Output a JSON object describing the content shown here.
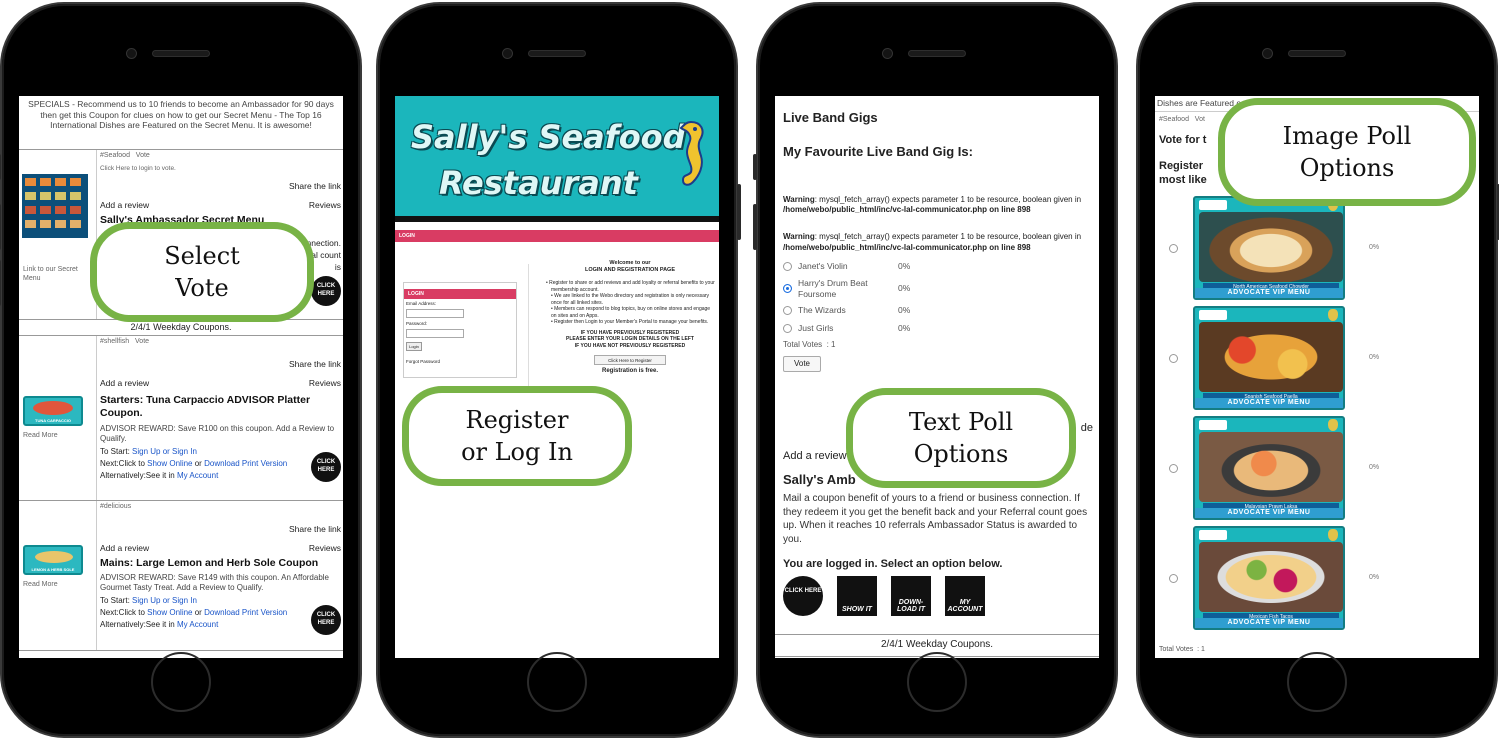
{
  "phone1": {
    "specials_text": "SPECIALS - Recommend us to 10 friends to become an Ambassador for 90 days then get this Coupon for clues on how to get our Secret Menu - The Top 16 International Dishes are Featured on the Secret Menu. It is awesome!",
    "card1": {
      "tags": "#Seafood   Vote",
      "login_note": "Click Here to login to vote.",
      "share": "Share the link",
      "add_review": "Add a review",
      "reviews": "Reviews",
      "title": "Sally's Ambassador Secret Menu",
      "side_link": "Link to our Secret Menu",
      "frag1": "connection.",
      "frag2": "rral count",
      "frag3": "is"
    },
    "weekday_bar": "2/4/1 Weekday Coupons.",
    "card2": {
      "tags": "#shellfish   Vote",
      "share": "Share the link",
      "add_review": "Add a review",
      "reviews": "Reviews",
      "title": "Starters: Tuna Carpaccio ADVISOR Platter Coupon.",
      "body": "ADVISOR REWARD: Save R100 on this coupon. Add a Review to Qualify.",
      "start_label": "To Start:",
      "start_link": "Sign Up or Sign In",
      "next_label": "Next:Click to",
      "show_online": "Show Online",
      "or": "or",
      "download": "Download Print Version",
      "alt_label": "Alternatively:See it in",
      "my_account": "My Account",
      "read_more": "Read More",
      "thumb_label": "TUNA CARPACCIO"
    },
    "card3": {
      "tags": "#delicious",
      "share": "Share the link",
      "add_review": "Add a review",
      "reviews": "Reviews",
      "title": "Mains: Large Lemon and Herb Sole Coupon",
      "body": "ADVISOR REWARD: Save R149 with this coupon. An Affordable Gourmet Tasty Treat. Add a Review to Qualify.",
      "start_label": "To Start:",
      "start_link": "Sign Up or Sign In",
      "next_label": "Next:Click to",
      "show_online": "Show Online",
      "or": "or",
      "download": "Download Print Version",
      "alt_label": "Alternatively:See it in",
      "my_account": "My Account",
      "read_more": "Read More",
      "thumb_label": "LEMON & HERB SOLE"
    },
    "badge": "CLICK HERE"
  },
  "phone2": {
    "logo_line1": "Sally's Seafood",
    "logo_line2": "Restaurant",
    "login_bar": "LOGIN",
    "login_box_title": "LOGIN",
    "email_label": "Email Address:",
    "password_label": "Password:",
    "login_button": "Login",
    "forgot": "Forgot Password",
    "welcome1": "Welcome to our",
    "welcome2": "LOGIN AND REGISTRATION PAGE",
    "bullets": [
      "Register to share or add reviews and add loyalty or referral benefits to your membership account.",
      "We are linked to the Webo directory and registration is only necessary once for all linked sites.",
      "Members can respond to blog topics, buy on online stores and engage on sites and on Apps.",
      "Register then Login to your Member's Portal to manage your benefits."
    ],
    "prev_reg": "IF YOU HAVE PREVIOUSLY REGISTERED",
    "enter_login": "PLEASE ENTER YOUR LOGIN DETAILS ON THE LEFT",
    "not_reg": "IF YOU HAVE NOT PREVIOUSLY REGISTERED",
    "register_button": "Click Here to Register",
    "free": "Registration is free."
  },
  "phone3": {
    "heading": "Live Band Gigs",
    "subheading": "My Favourite Live Band Gig Is:",
    "warning_label": "Warning",
    "warning_text": ": mysql_fetch_array() expects parameter 1 to be resource, boolean given in",
    "warning_path": "/home/webo/public_html/inc/vc-lal-communicator.php",
    "warning_line": "on line 898",
    "options": [
      {
        "label": "Janet's Violin",
        "pct": "0%",
        "selected": false
      },
      {
        "label": "Harry's Drum Beat Foursome",
        "pct": "0%",
        "selected": true
      },
      {
        "label": "The Wizards",
        "pct": "0%",
        "selected": false
      },
      {
        "label": "Just Girls",
        "pct": "0%",
        "selected": false
      }
    ],
    "total_votes": "Total Votes  : 1",
    "vote_button": "Vote",
    "de_frag": "de",
    "add_review": "Add a review",
    "ambassador_title": "Sally's Amb",
    "ambassador_body": "Mail a coupon benefit of yours to a friend or business connection. If they redeem it you get the benefit back and your Referral count goes up. When it reaches 10 referrals Ambassador Status is awarded to you.",
    "logged_in": "You are logged in. Select an option below.",
    "icons": [
      "SHOW IT",
      "DOWN-LOAD IT",
      "MY ACCOUNT"
    ],
    "badge": "CLICK HERE",
    "weekday_bar": "2/4/1 Weekday Coupons."
  },
  "phone4": {
    "top_text": "Dishes are Featured on the Secret Menu. It is awesome!",
    "tags_line": "#Seafood   Vot",
    "vote_for": "Vote for t",
    "register_line": "Register",
    "most_like": "most like",
    "items": [
      {
        "caption": "North American Seafood Chowder",
        "pct": "0%"
      },
      {
        "caption": "Spanish Seafood Paella",
        "pct": "0%"
      },
      {
        "caption": "Malaysian Prawn Laksa",
        "pct": "0%"
      },
      {
        "caption": "Mexican Fish Tacos",
        "pct": "0%"
      }
    ],
    "vip_label": "ADVOCATE VIP MENU",
    "total_votes": "Total Votes  : 1"
  },
  "callouts": {
    "select_vote": "Select\nVote",
    "register": "Register\nor Log In",
    "text_poll": "Text Poll\nOptions",
    "image_poll": "Image Poll\nOptions"
  },
  "colors": {
    "callout_border": "#78b346",
    "banner_teal": "#1bb6bc",
    "login_pink": "#d93c63",
    "link_blue": "#1a55c8"
  }
}
